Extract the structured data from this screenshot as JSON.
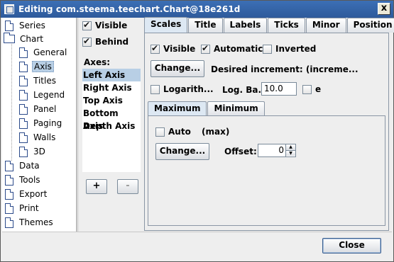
{
  "window": {
    "title": "Editing com.steema.teechart.Chart@18e261d",
    "close_glyph": "x"
  },
  "tree": {
    "items": [
      {
        "label": "Series",
        "icon": "document-icon",
        "level": 0
      },
      {
        "label": "Chart",
        "icon": "folder-open-icon",
        "level": 0
      },
      {
        "label": "General",
        "icon": "document-icon",
        "level": 1
      },
      {
        "label": "Axis",
        "icon": "document-icon",
        "level": 1,
        "selected": true
      },
      {
        "label": "Titles",
        "icon": "document-icon",
        "level": 1
      },
      {
        "label": "Legend",
        "icon": "document-icon",
        "level": 1
      },
      {
        "label": "Panel",
        "icon": "document-icon",
        "level": 1
      },
      {
        "label": "Paging",
        "icon": "document-icon",
        "level": 1
      },
      {
        "label": "Walls",
        "icon": "document-icon",
        "level": 1
      },
      {
        "label": "3D",
        "icon": "document-icon",
        "level": 1
      },
      {
        "label": "Data",
        "icon": "document-icon",
        "level": 0
      },
      {
        "label": "Tools",
        "icon": "document-icon",
        "level": 0
      },
      {
        "label": "Export",
        "icon": "document-icon",
        "level": 0
      },
      {
        "label": "Print",
        "icon": "document-icon",
        "level": 0
      },
      {
        "label": "Themes",
        "icon": "document-icon",
        "level": 0
      }
    ]
  },
  "middle": {
    "visible_label": "Visible",
    "visible_checked": true,
    "behind_label": "Behind",
    "behind_checked": true,
    "axes_title": "Axes:",
    "axes": [
      "Left Axis",
      "Right Axis",
      "Top Axis",
      "Bottom Axis",
      "Depth Axis"
    ],
    "selected_axis": "Left Axis",
    "add_label": "+",
    "remove_label": "-"
  },
  "tabs": [
    "Scales",
    "Title",
    "Labels",
    "Ticks",
    "Minor",
    "Position"
  ],
  "active_tab": "Scales",
  "scales": {
    "visible_label": "Visible",
    "visible_checked": true,
    "automatic_label": "Automatic",
    "automatic_checked": true,
    "inverted_label": "Inverted",
    "inverted_checked": false,
    "change_label": "Change...",
    "increment_label": "Desired increment: (increme...",
    "logarithmic_label": "Logarith...",
    "logarithmic_checked": false,
    "log_base_label": "Log. Ba...",
    "log_base_value": "10.0",
    "e_label": "e",
    "e_checked": false
  },
  "subtabs": [
    "Maximum",
    "Minimum"
  ],
  "active_subtab": "Maximum",
  "maximum": {
    "auto_label": "Auto",
    "auto_checked": false,
    "max_label": "(max)",
    "change_label": "Change...",
    "offset_label": "Offset:",
    "offset_value": "0"
  },
  "footer": {
    "close_label": "Close"
  },
  "colors": {
    "titlebar": "#3c6fb5",
    "selection": "#b8cfe5"
  }
}
